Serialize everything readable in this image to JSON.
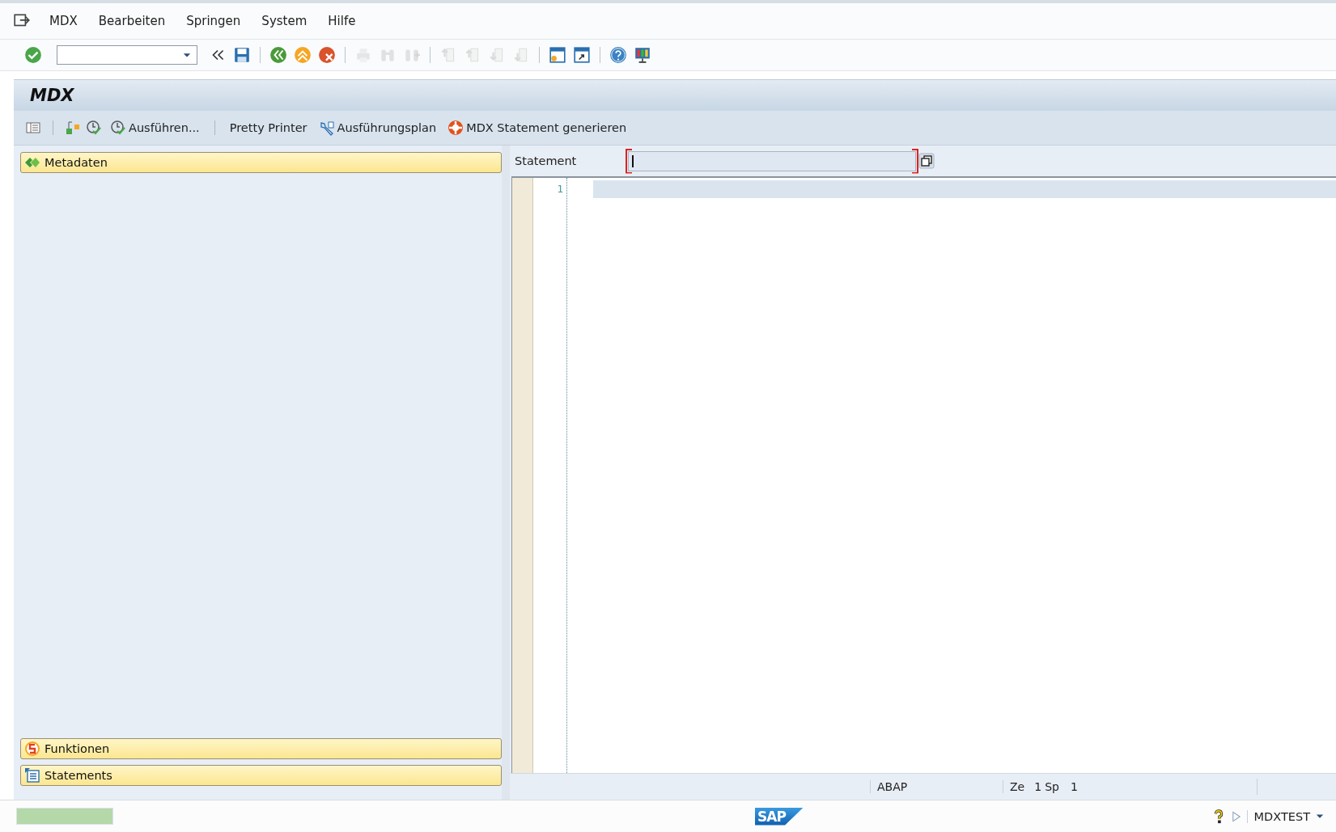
{
  "menu_bar": {
    "items": [
      {
        "label": "MDX"
      },
      {
        "label": "Bearbeiten"
      },
      {
        "label": "Springen"
      },
      {
        "label": "System"
      },
      {
        "label": "Hilfe"
      }
    ]
  },
  "system_toolbar": {
    "buttons": [
      {
        "kind": "enter",
        "disabled": false
      },
      {
        "kind": "command-field"
      },
      {
        "kind": "collapse",
        "disabled": false
      },
      {
        "kind": "save",
        "disabled": false
      },
      {
        "kind": "separator"
      },
      {
        "kind": "back",
        "disabled": false
      },
      {
        "kind": "exit",
        "disabled": false
      },
      {
        "kind": "cancel",
        "disabled": false
      },
      {
        "kind": "separator"
      },
      {
        "kind": "print",
        "disabled": true
      },
      {
        "kind": "find",
        "disabled": true
      },
      {
        "kind": "find-next",
        "disabled": true
      },
      {
        "kind": "separator"
      },
      {
        "kind": "first-page",
        "disabled": true
      },
      {
        "kind": "prev-page",
        "disabled": true
      },
      {
        "kind": "next-page",
        "disabled": true
      },
      {
        "kind": "last-page",
        "disabled": true
      },
      {
        "kind": "separator"
      },
      {
        "kind": "new-session",
        "disabled": false
      },
      {
        "kind": "shortcut",
        "disabled": false
      },
      {
        "kind": "separator"
      },
      {
        "kind": "help",
        "disabled": false
      },
      {
        "kind": "layout",
        "disabled": false
      }
    ]
  },
  "title": "MDX",
  "application_toolbar": {
    "buttons": [
      {
        "kind": "list"
      },
      {
        "kind": "separator"
      },
      {
        "kind": "hierarchy"
      },
      {
        "kind": "check"
      },
      {
        "kind": "execute",
        "label": "Ausführen..."
      },
      {
        "kind": "separator"
      },
      {
        "kind": "text",
        "label": "Pretty Printer"
      },
      {
        "kind": "plan",
        "label": "Ausführungsplan"
      },
      {
        "kind": "generate",
        "label": "MDX Statement generieren"
      }
    ]
  },
  "left_panel": {
    "top_sections": [
      {
        "kind": "metadata",
        "label": "Metadaten"
      }
    ],
    "bottom_sections": [
      {
        "kind": "functions",
        "label": "Funktionen"
      },
      {
        "kind": "statements",
        "label": "Statements"
      }
    ]
  },
  "editor": {
    "statement_label": "Statement",
    "line_numbers": [
      "1"
    ],
    "language": "ABAP",
    "line_label": "Ze",
    "line": "1",
    "column_label": "Sp",
    "column": "1"
  },
  "status_bar": {
    "logo": "SAP",
    "system": "MDXTEST"
  }
}
